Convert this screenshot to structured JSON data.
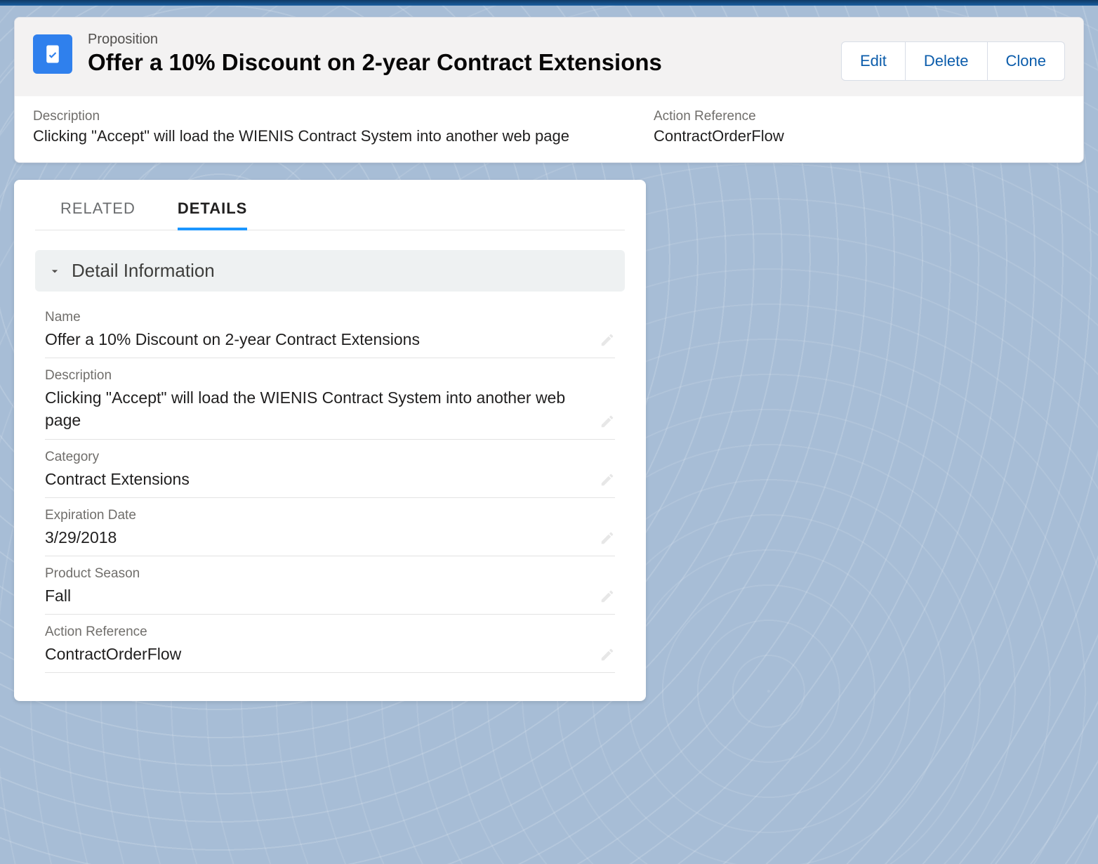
{
  "header": {
    "object_label": "Proposition",
    "title": "Offer a 10% Discount on 2-year Contract Extensions",
    "actions": {
      "edit": "Edit",
      "delete": "Delete",
      "clone": "Clone"
    },
    "summary": {
      "description_label": "Description",
      "description_value": "Clicking \"Accept\" will load the WIENIS Contract System into another web page",
      "action_ref_label": "Action Reference",
      "action_ref_value": "ContractOrderFlow"
    }
  },
  "tabs": {
    "related": "RELATED",
    "details": "DETAILS"
  },
  "section": {
    "title": "Detail Information"
  },
  "fields": {
    "name_label": "Name",
    "name_value": "Offer a 10% Discount on 2-year Contract Extensions",
    "description_label": "Description",
    "description_value": "Clicking \"Accept\" will load the WIENIS Contract System into another web page",
    "category_label": "Category",
    "category_value": "Contract Extensions",
    "expiration_label": "Expiration Date",
    "expiration_value": "3/29/2018",
    "season_label": "Product Season",
    "season_value": "Fall",
    "action_ref_label": "Action Reference",
    "action_ref_value": "ContractOrderFlow"
  }
}
